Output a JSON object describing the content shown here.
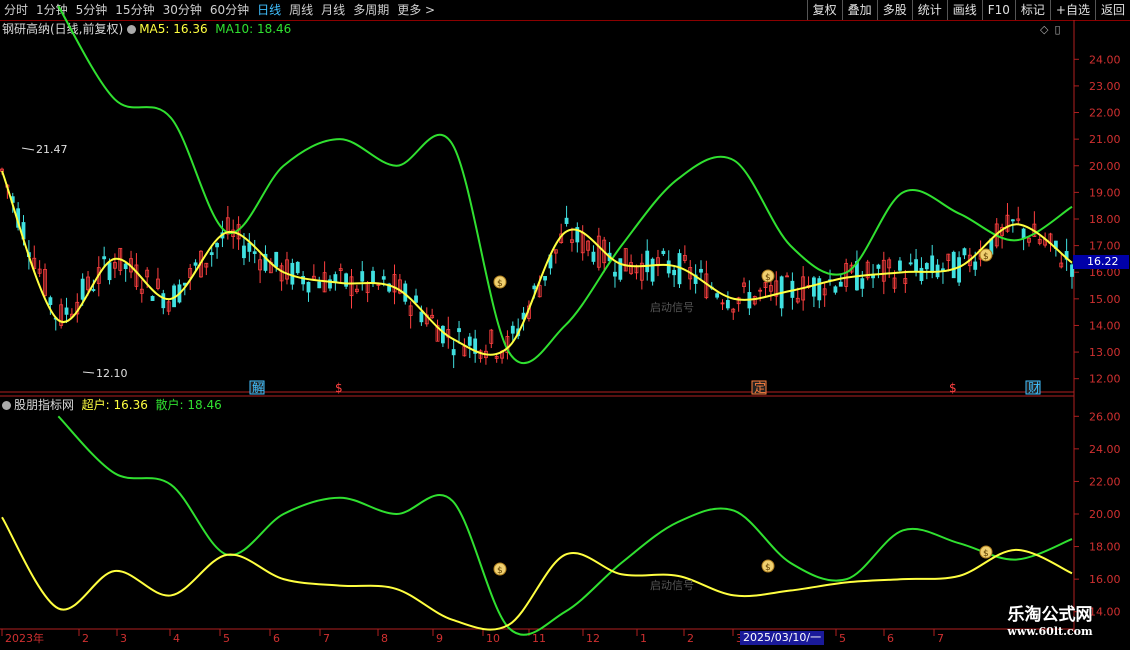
{
  "toolbar": {
    "periods": [
      "分时",
      "1分钟",
      "5分钟",
      "15分钟",
      "30分钟",
      "60分钟",
      "日线",
      "周线",
      "月线",
      "多周期",
      "更多 >"
    ],
    "active_period": "日线",
    "actions": [
      "复权",
      "叠加",
      "多股",
      "统计",
      "画线",
      "F10",
      "标记",
      "+自选",
      "返回"
    ]
  },
  "main_panel": {
    "stock": "钢研高纳(日线,前复权)",
    "ma5_label": "MA5: 16.36",
    "ma10_label": "MA10: 18.46",
    "current_price": "16.22",
    "high_label": "21.47",
    "low_label": "12.10",
    "yticks": [
      "24.00",
      "23.00",
      "22.00",
      "21.00",
      "20.00",
      "19.00",
      "18.00",
      "17.00",
      "16.00",
      "15.00",
      "14.00",
      "13.00",
      "12.00"
    ],
    "event_markers": [
      "解",
      "$",
      "定",
      "$",
      "财"
    ],
    "faint_text": "启动信号"
  },
  "sub_panel": {
    "name": "股朋指标网",
    "super_label": "超户: 16.36",
    "retail_label": "散户: 18.46",
    "yticks": [
      "26.00",
      "24.00",
      "22.00",
      "20.00",
      "18.00",
      "16.00",
      "14.00"
    ],
    "faint_text": "启动信号"
  },
  "x_axis": {
    "labels": [
      "2023年",
      "2",
      "3",
      "4",
      "5",
      "6",
      "7",
      "8",
      "9",
      "10",
      "11",
      "12",
      "1",
      "2",
      "3",
      "2025/03/10/一",
      "5",
      "6",
      "7"
    ]
  },
  "watermark": {
    "line1": "乐淘公式网",
    "line2": "www.60lt.com"
  },
  "colors": {
    "up": "#ff4040",
    "down": "#40e0e0",
    "ma5": "#ffff40",
    "ma10": "#30e030",
    "axis": "#b02020"
  },
  "chart_data": {
    "type": "line",
    "title": "钢研高纳(日线,前复权)",
    "x": [
      "2023年",
      "2",
      "3",
      "4",
      "5",
      "6",
      "7",
      "8",
      "9",
      "10",
      "11",
      "12",
      "1",
      "2",
      "3",
      "4",
      "5",
      "6",
      "7"
    ],
    "series": [
      {
        "name": "MA5",
        "values": [
          19.8,
          14.2,
          16.5,
          15.0,
          17.5,
          16.0,
          15.6,
          15.4,
          13.5,
          13.2,
          17.5,
          16.3,
          16.2,
          15.0,
          15.3,
          15.8,
          16.0,
          16.2,
          17.8,
          16.36
        ]
      },
      {
        "name": "MA10",
        "values": [
          null,
          26.0,
          22.5,
          21.8,
          17.5,
          20.0,
          21.0,
          20.0,
          20.8,
          13.0,
          14.0,
          17.0,
          19.5,
          20.2,
          17.0,
          16.0,
          19.0,
          18.2,
          17.2,
          18.46
        ]
      }
    ],
    "ylim": [
      11.5,
      24.8
    ],
    "sub_chart": {
      "type": "line",
      "title": "股朋指标网",
      "series": [
        {
          "name": "超户",
          "values": [
            19.8,
            14.2,
            16.5,
            15.0,
            17.5,
            16.0,
            15.6,
            15.4,
            13.5,
            13.2,
            17.5,
            16.3,
            16.2,
            15.0,
            15.3,
            15.8,
            16.0,
            16.2,
            17.8,
            16.36
          ]
        },
        {
          "name": "散户",
          "values": [
            null,
            26.0,
            22.5,
            21.8,
            17.5,
            20.0,
            21.0,
            20.0,
            20.8,
            13.0,
            14.0,
            17.0,
            19.5,
            20.2,
            17.0,
            16.0,
            19.0,
            18.2,
            17.2,
            18.46
          ]
        }
      ],
      "ylim": [
        13.0,
        27.0
      ]
    }
  }
}
